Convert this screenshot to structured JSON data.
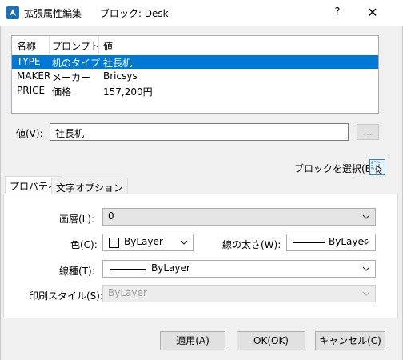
{
  "window": {
    "title": "拡張属性編集",
    "subtitle": "ブロック: Desk",
    "help_label": "?",
    "close_label": "✕"
  },
  "attributes": {
    "columns": [
      "名称",
      "プロンプト",
      "値"
    ],
    "rows": [
      {
        "name": "TYPE",
        "prompt": "机のタイプ",
        "value": "社長机",
        "selected": true
      },
      {
        "name": "MAKER",
        "prompt": "メーカー",
        "value": "Bricsys",
        "selected": false
      },
      {
        "name": "PRICE",
        "prompt": "価格",
        "value": "157,200円",
        "selected": false
      }
    ]
  },
  "value_field": {
    "label": "値(V):",
    "value": "社長机",
    "ellipsis_label": "..."
  },
  "select_block": {
    "label": "ブロックを選択(B)"
  },
  "tabs": [
    {
      "label": "プロパティ",
      "active": true
    },
    {
      "label": "文字オプション",
      "active": false
    }
  ],
  "properties": {
    "layer": {
      "label": "画層(L):",
      "value": "0"
    },
    "color": {
      "label": "色(C):",
      "value": "ByLayer",
      "swatch": "#ffffff"
    },
    "lineweight": {
      "label": "線の太さ(W):",
      "value": "ByLayer"
    },
    "linetype": {
      "label": "線種(T):",
      "value": "ByLayer"
    },
    "plotstyle": {
      "label": "印刷スタイル(S):",
      "value": "ByLayer",
      "disabled": true
    }
  },
  "buttons": {
    "apply": "適用(A)",
    "ok": "OK(OK)",
    "cancel": "キャンセル(C)"
  },
  "colors": {
    "selection": "#0078d7",
    "app_icon": "#1e6fb8"
  }
}
